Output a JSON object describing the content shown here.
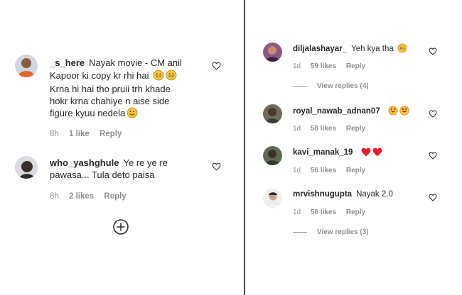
{
  "left_comments": [
    {
      "username": "_s_here",
      "text_lines": [
        "Nayak movie - CM anil",
        "Kapoor ki copy kr rhi hai",
        "Krna hi hai tho pruii trh khade",
        "hokr krna chahiye n aise side",
        "figure kyuu nedela"
      ],
      "time": "8h",
      "likes": "1 like",
      "reply": "Reply"
    },
    {
      "username": "who_yashghule",
      "text_lines": [
        "Ye re ye re",
        "pawasa... Tula deto paisa"
      ],
      "time": "8h",
      "likes": "2 likes",
      "reply": "Reply"
    }
  ],
  "right_comments": [
    {
      "username": "diljalashayar_",
      "text": "Yeh kya tha",
      "time": "1d",
      "likes": "59 likes",
      "reply": "Reply",
      "view_replies": "View replies (4)"
    },
    {
      "username": "royal_nawab_adnan07",
      "text": "",
      "time": "1d",
      "likes": "58 likes",
      "reply": "Reply"
    },
    {
      "username": "kavi_manak_19",
      "text": "",
      "time": "1d",
      "likes": "56 likes",
      "reply": "Reply"
    },
    {
      "username": "mrvishnugupta",
      "text": "Nayak 2.0",
      "time": "1d",
      "likes": "56 likes",
      "reply": "Reply",
      "view_replies": "View replies (3)"
    }
  ],
  "icons": {
    "like": "heart-outline-icon",
    "load_more": "plus-circle-icon",
    "emoji_smile": "smiling-face-emoji",
    "emoji_laugh": "grinning-sweat-emoji",
    "emoji_heart_eyes": "heart-eyes-emoji",
    "emoji_heart": "red-heart-emoji"
  },
  "colors": {
    "text": "#262626",
    "meta": "#8e8e8e",
    "divider": "#4a4a4a"
  }
}
